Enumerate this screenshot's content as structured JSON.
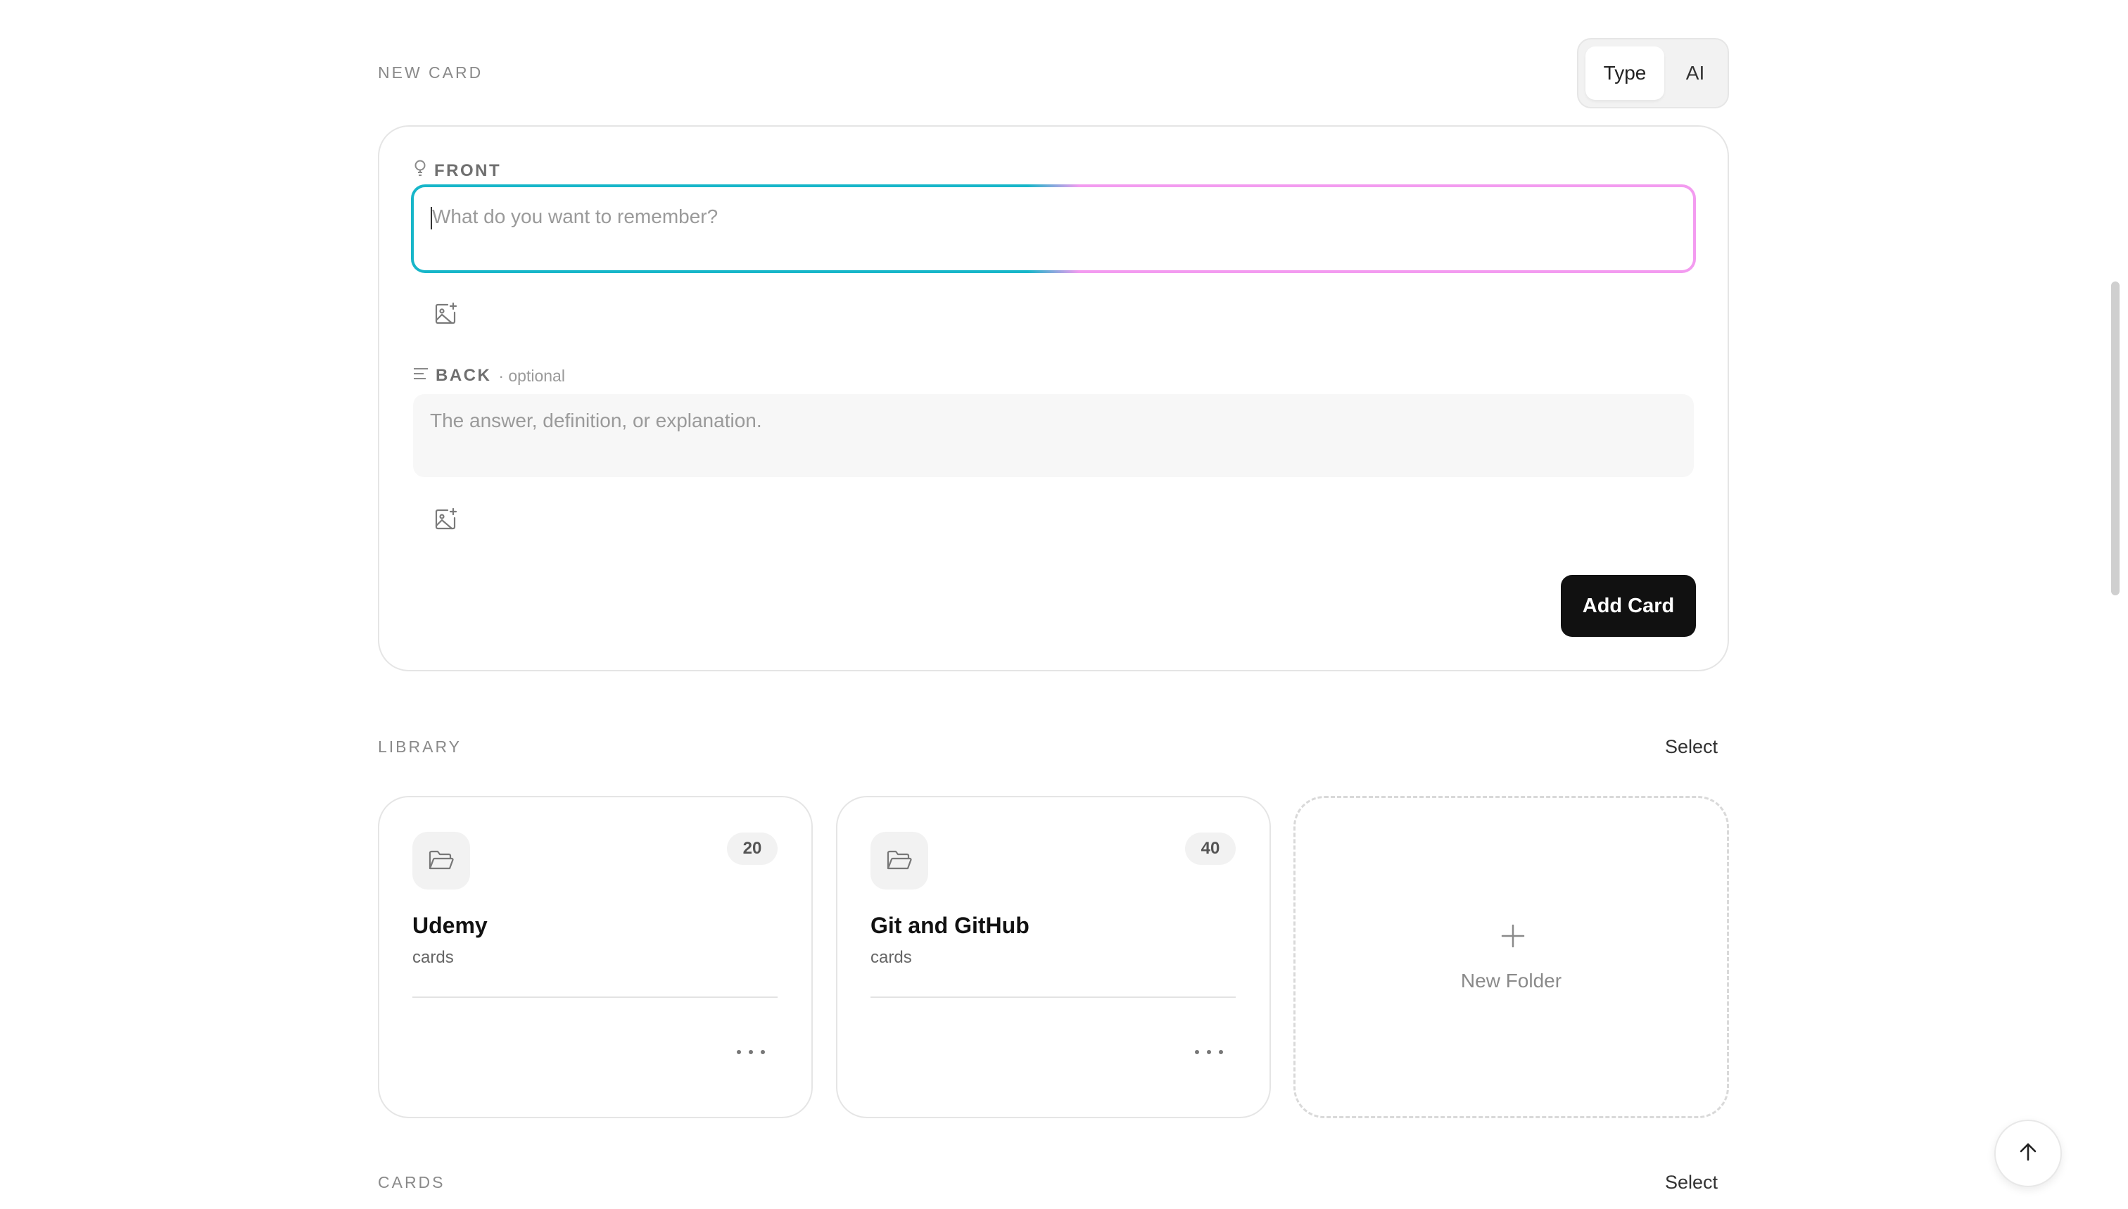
{
  "new_card": {
    "section_label": "NEW CARD",
    "mode_toggle": {
      "options": [
        "Type",
        "AI"
      ],
      "selected": "Type"
    },
    "front": {
      "label": "FRONT",
      "placeholder": "What do you want to remember?",
      "value": ""
    },
    "back": {
      "label": "BACK",
      "optional_text": "· optional",
      "placeholder": "The answer, definition, or explanation.",
      "value": ""
    },
    "add_button_label": "Add Card",
    "icons": {
      "front_label": "lightbulb-icon",
      "back_label": "text-lines-icon",
      "add_image": "image-plus-icon"
    },
    "colors": {
      "focus_gradient_start": "#17b6c9",
      "focus_gradient_end": "#f39bf0",
      "primary_button": "#111111"
    }
  },
  "library": {
    "section_label": "LIBRARY",
    "select_label": "Select",
    "folders": [
      {
        "name": "Udemy",
        "count": "20",
        "subtitle": "cards",
        "icon": "folder-open-icon"
      },
      {
        "name": "Git and GitHub",
        "count": "40",
        "subtitle": "cards",
        "icon": "folder-open-icon"
      }
    ],
    "new_folder_label": "New Folder"
  },
  "cards": {
    "section_label": "CARDS",
    "select_label": "Select"
  },
  "scroll_to_top_icon": "arrow-up-icon"
}
